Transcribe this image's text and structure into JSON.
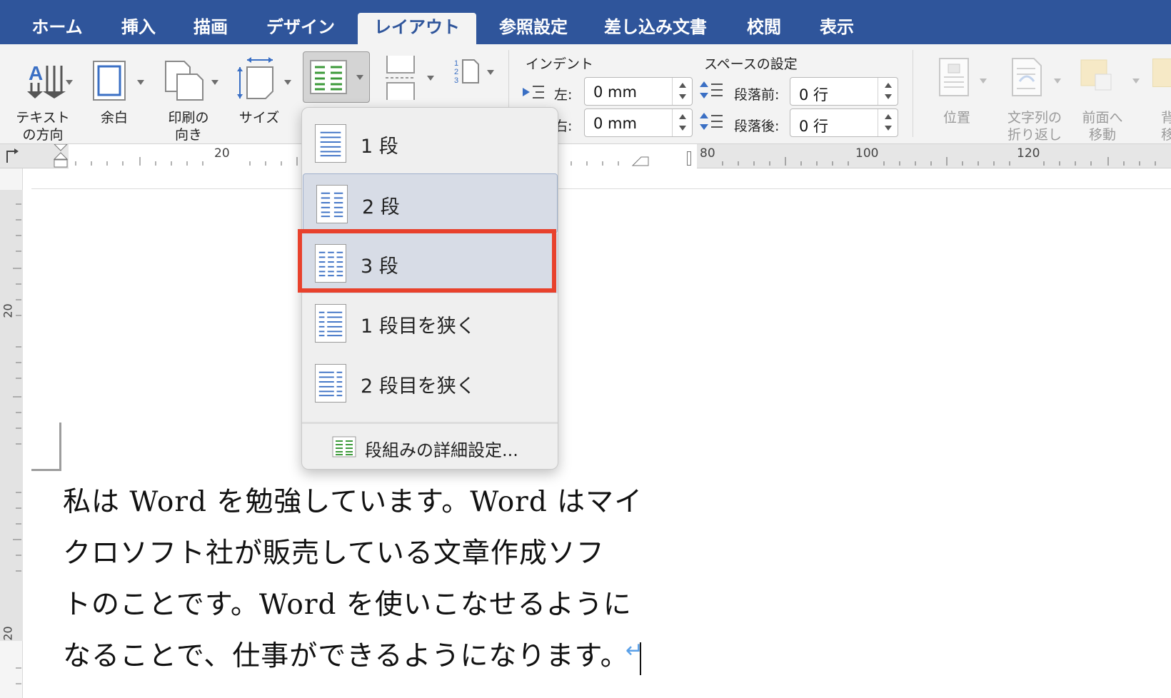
{
  "tabs": [
    {
      "label": "ホーム",
      "active": false
    },
    {
      "label": "挿入",
      "active": false
    },
    {
      "label": "描画",
      "active": false
    },
    {
      "label": "デザイン",
      "active": false
    },
    {
      "label": "レイアウト",
      "active": true
    },
    {
      "label": "参照設定",
      "active": false
    },
    {
      "label": "差し込み文書",
      "active": false
    },
    {
      "label": "校閲",
      "active": false
    },
    {
      "label": "表示",
      "active": false
    }
  ],
  "ribbon": {
    "text_direction": {
      "line1": "テキスト",
      "line2": "の方向",
      "icon": "text-direction-icon"
    },
    "margins": {
      "label": "余白",
      "icon": "margins-icon"
    },
    "orientation": {
      "line1": "印刷の",
      "line2": "向き",
      "icon": "orientation-icon"
    },
    "size": {
      "label": "サイズ",
      "icon": "page-size-icon"
    },
    "columns": {
      "icon": "columns-icon",
      "expanded": true
    },
    "breaks": {
      "icon": "page-breaks-icon"
    },
    "line_numbers": {
      "icon": "line-numbers-icon",
      "digits": [
        "1",
        "2",
        "3"
      ]
    },
    "indent": {
      "title": "インデント",
      "left_label": "左:",
      "left_value": "0 mm",
      "right_label": "右:",
      "right_value": "0 mm"
    },
    "spacing": {
      "title": "スペースの設定",
      "before_label": "段落前:",
      "before_value": "0 行",
      "after_label": "段落後:",
      "after_value": "0 行"
    },
    "position": {
      "label": "位置",
      "enabled": false
    },
    "wrap_text": {
      "line1": "文字列の",
      "line2": "折り返し",
      "enabled": false
    },
    "bring_forward": {
      "line1": "前面へ",
      "line2": "移動",
      "enabled": false
    },
    "send_backward": {
      "line1": "背",
      "line2": "移",
      "enabled": false
    }
  },
  "ruler": {
    "horizontal_labels": [
      "20",
      "80",
      "100",
      "120"
    ],
    "vertical_labels": [
      "20",
      "20"
    ]
  },
  "columns_menu": {
    "items": [
      {
        "label": "1 段",
        "icon": "one-column-icon",
        "state": "normal"
      },
      {
        "label": "2 段",
        "icon": "two-columns-icon",
        "state": "hover"
      },
      {
        "label": "3 段",
        "icon": "three-columns-icon",
        "state": "selected-highlighted"
      },
      {
        "label": "1 段目を狭く",
        "icon": "left-narrow-column-icon",
        "state": "normal"
      },
      {
        "label": "2 段目を狭く",
        "icon": "right-narrow-column-icon",
        "state": "normal"
      }
    ],
    "detail": {
      "label": "段組みの詳細設定...",
      "icon": "column-settings-icon"
    },
    "highlight_color": "#e8412c"
  },
  "document": {
    "lines": [
      "私は Word を勉強しています。Word はマイ",
      "クロソフト社が販売している文章作成ソフ",
      "トのことです。Word を使いこなせるように",
      "なることで、仕事ができるようになります。"
    ],
    "paragraph_mark": "↵"
  },
  "colors": {
    "tab_bar": "#2f559b",
    "ribbon_bg": "#f3f3f3",
    "icon_blue": "#3a6fc4",
    "icon_green": "#3c9a3a"
  }
}
